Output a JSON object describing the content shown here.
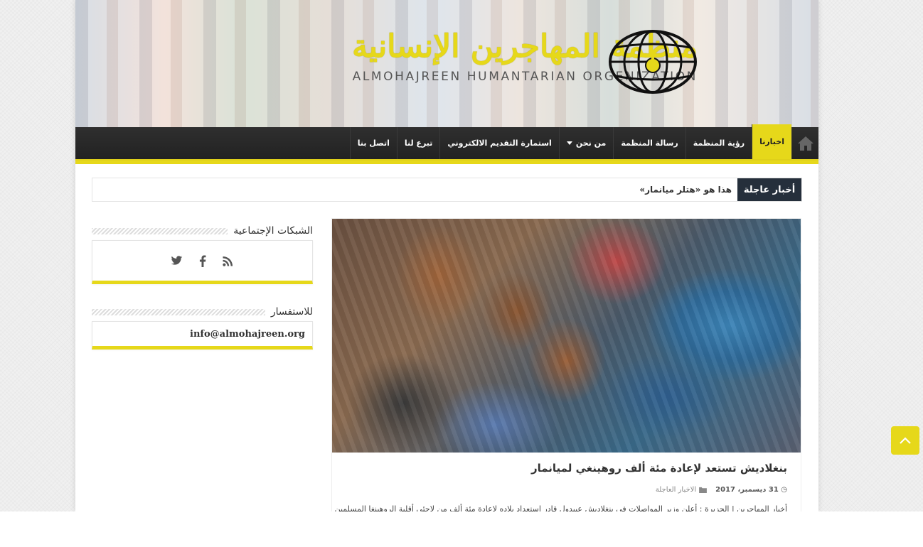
{
  "header": {
    "title_ar": "منظمة المهاجرين الإنسانية",
    "title_en": "ALMOHAJREEN HUMANTARIAN ORGENIZATION",
    "logo_icon": "globe-icon"
  },
  "nav": {
    "home_icon": "home-icon",
    "items": [
      {
        "label": "اخبارنا",
        "active": true
      },
      {
        "label": "رؤية المنظمة"
      },
      {
        "label": "رسالة المنظمة"
      },
      {
        "label": "من نحن",
        "has_dropdown": true
      },
      {
        "label": "استمارة التقديم الالكتروني"
      },
      {
        "label": "تبرع لنا"
      },
      {
        "label": "اتصل بنا"
      }
    ]
  },
  "breaking": {
    "label": "أخبار عاجلة",
    "headline": "هذا هو «هتلر ميانمار»"
  },
  "sidebar": {
    "social_title": "الشبكات الإجتماعية",
    "social_icons": [
      "rss-icon",
      "facebook-icon",
      "twitter-icon"
    ],
    "contact_title": "للاستفسار",
    "contact_email": "info@almohajreen.org"
  },
  "post": {
    "title": "بنغلاديش تستعد لإعادة مئة ألف روهينغي لميانمار",
    "date": "31 ديسمبر، 2017",
    "category": "الاخبار العاجلة",
    "excerpt": "أخبار المهاجرين | الجزيرة : أعلن وزير المواصلات في بنغلاديش عبيدول قادر استعداد بلاده لإعادة مئة ألف من لاجئي أقلية الروهينغا المسلمين"
  },
  "colors": {
    "accent": "#e6d81a",
    "nav_bg": "#2a2a2a",
    "breaking_bg": "#252f3b"
  }
}
